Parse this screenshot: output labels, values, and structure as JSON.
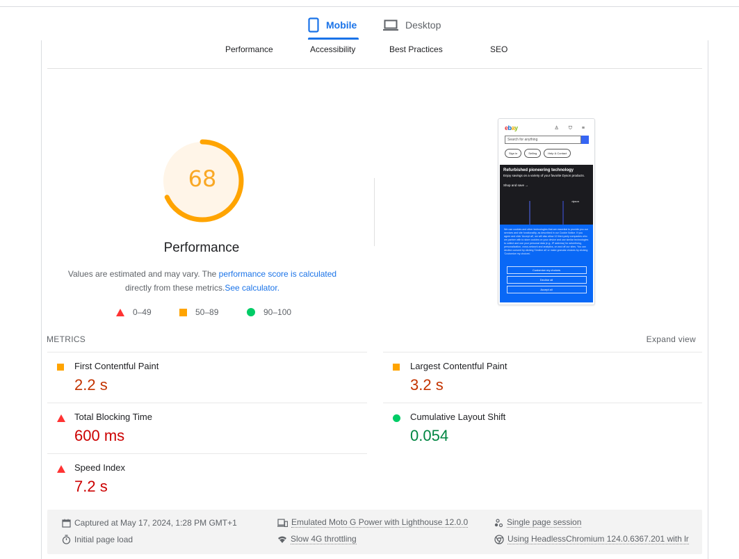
{
  "device_tabs": [
    {
      "label": "Mobile",
      "icon": "smartphone-icon",
      "active": true
    },
    {
      "label": "Desktop",
      "icon": "laptop-icon",
      "active": false
    }
  ],
  "category_tabs": [
    "Performance",
    "Accessibility",
    "Best Practices",
    "SEO"
  ],
  "score": {
    "value": "68",
    "fraction": 0.68,
    "title": "Performance",
    "color": "#ffa400"
  },
  "description": {
    "text1": "Values are estimated and may vary. The ",
    "link1": "performance score is calculated",
    "text2": "directly from these metrics.",
    "link2": "See calculator",
    "text3": "."
  },
  "legend": [
    {
      "shape": "triangle",
      "range": "0–49",
      "color": "#ff3333"
    },
    {
      "shape": "square",
      "range": "50–89",
      "color": "#ffa400"
    },
    {
      "shape": "circle",
      "range": "90–100",
      "color": "#00cc66"
    }
  ],
  "screenshot": {
    "logo": [
      "e",
      "b",
      "a",
      "y"
    ],
    "header_icons": "♙ ⛉ ≡",
    "search_placeholder": "Search for anything",
    "pills": [
      "Sign in",
      "Selling",
      "Help & Contact"
    ],
    "hero_title": "Refurbished pioneering technology",
    "hero_sub": "Enjoy savings on a variety of your favorite Dyson products.",
    "hero_cta": "Shop and save →",
    "hero_brand": "dyson",
    "cookie_text": "We use cookies and other technologies that are essential to provide you our services and site functionality, as described in our Cookie Notice. If you agree and click 'Accept all', we will also allow 12 third-party companies who we partner with to store cookies on your device and use similar technologies to collect and use your personal data (e.g., IP address) for advertising, personalization, cross-network and analytics, on and off our sites. You can decline consent by clicking 'Decline all' or make granular choices by clicking 'Customize my choices'.",
    "cookie_buttons": [
      "Customize my choices",
      "Decline all",
      "Accept all"
    ]
  },
  "metrics": {
    "section_label": "METRICS",
    "expand_label": "Expand view",
    "items": [
      {
        "name": "First Contentful Paint",
        "value": "2.2 s",
        "rating": "average"
      },
      {
        "name": "Largest Contentful Paint",
        "value": "3.2 s",
        "rating": "average"
      },
      {
        "name": "Total Blocking Time",
        "value": "600 ms",
        "rating": "fail"
      },
      {
        "name": "Cumulative Layout Shift",
        "value": "0.054",
        "rating": "pass"
      },
      {
        "name": "Speed Index",
        "value": "7.2 s",
        "rating": "fail"
      }
    ]
  },
  "footer": {
    "captured": "Captured at May 17, 2024, 1:28 PM GMT+1",
    "page_load": "Initial page load",
    "emulated": "Emulated Moto G Power with Lighthouse 12.0.0",
    "throttling": "Slow 4G throttling",
    "session": "Single page session",
    "browser": "Using HeadlessChromium 124.0.6367.201 with lr"
  }
}
